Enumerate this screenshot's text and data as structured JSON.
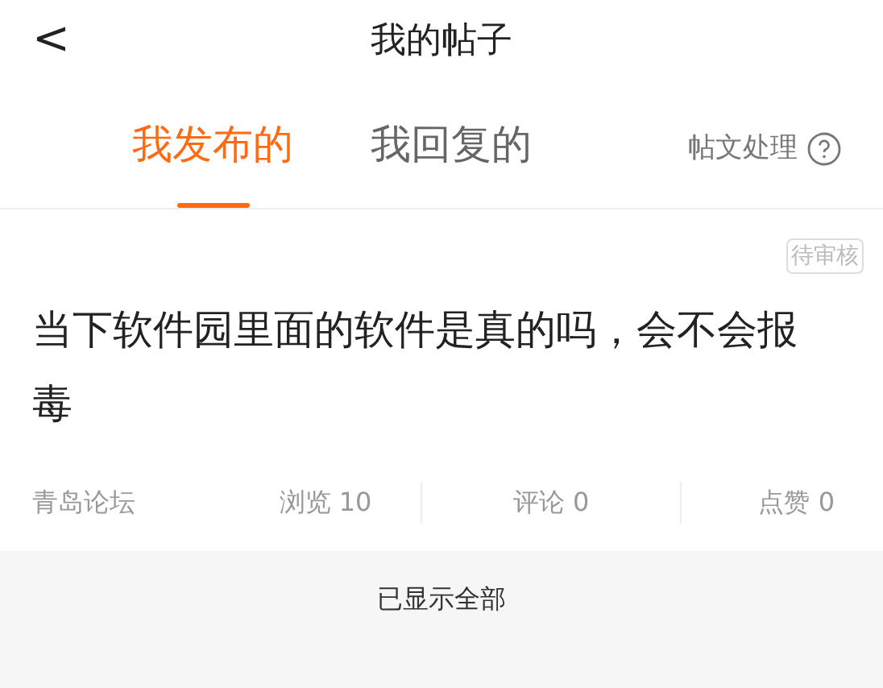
{
  "header": {
    "back_icon": "<",
    "title": "我的帖子"
  },
  "tabs": [
    {
      "label": "我发布的",
      "selected": true
    },
    {
      "label": "我回复的",
      "selected": false
    }
  ],
  "post_action": {
    "label": "帖文处理"
  },
  "posts": [
    {
      "status": "待审核",
      "title": "当下软件园里面的软件是真的吗，会不会报毒",
      "forum": "青岛论坛",
      "views": "浏览 10",
      "comments": "评论 0",
      "likes": "点赞 0"
    }
  ],
  "footer": "已显示全部"
}
